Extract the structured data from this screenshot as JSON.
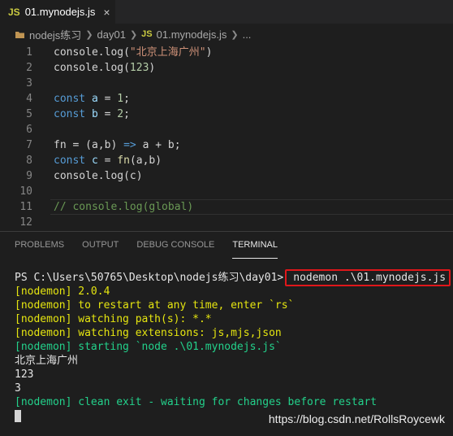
{
  "tab": {
    "badge": "JS",
    "filename": "01.mynodejs.js",
    "close": "×"
  },
  "breadcrumb": {
    "folder": "nodejs练习",
    "subfolder": "day01",
    "badge": "JS",
    "file": "01.mynodejs.js",
    "more": "..."
  },
  "editor": {
    "line_numbers": [
      "1",
      "2",
      "3",
      "4",
      "5",
      "6",
      "7",
      "8",
      "9",
      "10",
      "11",
      "12"
    ],
    "lines": {
      "l1": {
        "a": "console.log(",
        "b": "\"北京上海广州\"",
        "c": ")"
      },
      "l2": {
        "a": "console.log(",
        "b": "123",
        "c": ")"
      },
      "l4": {
        "kw": "const",
        "v": "a",
        "eq": " = ",
        "n": "1",
        "end": ";"
      },
      "l5": {
        "kw": "const",
        "v": "b",
        "eq": " = ",
        "n": "2",
        "end": ";"
      },
      "l7": {
        "a": "fn = (a,b) ",
        "arrow": "=>",
        "b": " a + b;"
      },
      "l8": {
        "kw": "const",
        "v": "c",
        "eq": " = ",
        "fn": "fn",
        "end": "(a,b)"
      },
      "l9": {
        "a": "console.log(c)"
      },
      "l11": {
        "cmt": "// console.log(global)"
      }
    }
  },
  "panel": {
    "tabs": [
      "PROBLEMS",
      "OUTPUT",
      "DEBUG CONSOLE",
      "TERMINAL"
    ],
    "active_tab": "TERMINAL"
  },
  "terminal": {
    "prompt": "PS C:\\Users\\50765\\Desktop\\nodejs练习\\day01>",
    "command": "nodemon .\\01.mynodejs.js",
    "lines": [
      "[nodemon] 2.0.4",
      "[nodemon] to restart at any time, enter `rs`",
      "[nodemon] watching path(s): *.*",
      "[nodemon] watching extensions: js,mjs,json",
      "[nodemon] starting `node .\\01.mynodejs.js`",
      "北京上海广州",
      "123",
      "3",
      "[nodemon] clean exit - waiting for changes before restart"
    ]
  },
  "watermark": "https://blog.csdn.net/RollsRoycewk",
  "colors": {
    "accent_box": "#e0171a",
    "nodemon_yellow": "#e5e510",
    "nodemon_green": "#23d18b",
    "background": "#1e1e1e"
  }
}
